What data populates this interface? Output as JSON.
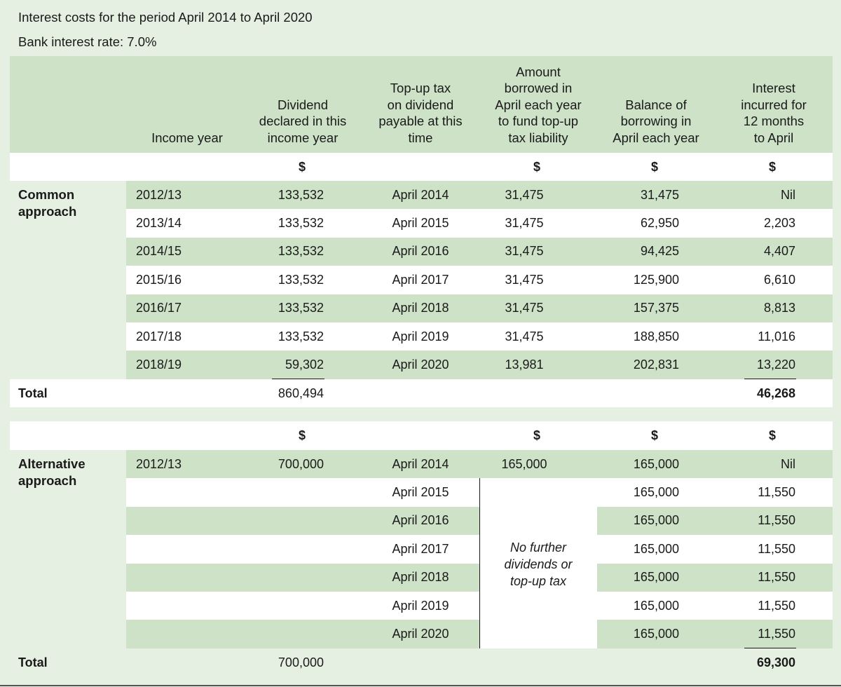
{
  "title": "Interest costs for the period April 2014 to April 2020",
  "subtitle": "Bank interest rate: 7.0%",
  "headers": {
    "income_year": "Income year",
    "dividend": "Dividend\ndeclared in this\nincome year",
    "topup": "Top-up tax\non dividend\npayable at this\ntime",
    "borrowed": "Amount\nborrowed in\nApril each year\nto fund top-up\ntax liability",
    "balance": "Balance of\nborrowing in\nApril each year",
    "interest": "Interest\nincurred for\n12 months\nto April"
  },
  "currency": "$",
  "common": {
    "label": "Common\napproach",
    "rows": [
      {
        "year": "2012/13",
        "dividend": "133,532",
        "due": "April 2014",
        "borrowed": "31,475",
        "balance": "31,475",
        "interest": "Nil"
      },
      {
        "year": "2013/14",
        "dividend": "133,532",
        "due": "April 2015",
        "borrowed": "31,475",
        "balance": "62,950",
        "interest": "2,203"
      },
      {
        "year": "2014/15",
        "dividend": "133,532",
        "due": "April 2016",
        "borrowed": "31,475",
        "balance": "94,425",
        "interest": "4,407"
      },
      {
        "year": "2015/16",
        "dividend": "133,532",
        "due": "April 2017",
        "borrowed": "31,475",
        "balance": "125,900",
        "interest": "6,610"
      },
      {
        "year": "2016/17",
        "dividend": "133,532",
        "due": "April 2018",
        "borrowed": "31,475",
        "balance": "157,375",
        "interest": "8,813"
      },
      {
        "year": "2017/18",
        "dividend": "133,532",
        "due": "April 2019",
        "borrowed": "31,475",
        "balance": "188,850",
        "interest": "11,016"
      },
      {
        "year": "2018/19",
        "dividend": "59,302",
        "due": "April 2020",
        "borrowed": "13,981",
        "balance": "202,831",
        "interest": "13,220"
      }
    ],
    "total_label": "Total",
    "total_dividend": "860,494",
    "total_interest": "46,268"
  },
  "alternative": {
    "label": "Alternative\napproach",
    "rows": [
      {
        "year": "2012/13",
        "dividend": "700,000",
        "due": "April 2014",
        "borrowed": "165,000",
        "balance": "165,000",
        "interest": "Nil"
      },
      {
        "year": "",
        "dividend": "",
        "due": "April 2015",
        "borrowed": "",
        "balance": "165,000",
        "interest": "11,550"
      },
      {
        "year": "",
        "dividend": "",
        "due": "April 2016",
        "borrowed": "",
        "balance": "165,000",
        "interest": "11,550"
      },
      {
        "year": "",
        "dividend": "",
        "due": "April 2017",
        "borrowed": "",
        "balance": "165,000",
        "interest": "11,550"
      },
      {
        "year": "",
        "dividend": "",
        "due": "April 2018",
        "borrowed": "",
        "balance": "165,000",
        "interest": "11,550"
      },
      {
        "year": "",
        "dividend": "",
        "due": "April 2019",
        "borrowed": "",
        "balance": "165,000",
        "interest": "11,550"
      },
      {
        "year": "",
        "dividend": "",
        "due": "April 2020",
        "borrowed": "",
        "balance": "165,000",
        "interest": "11,550"
      }
    ],
    "note": "No further\ndividends or\ntop-up tax",
    "total_label": "Total",
    "total_dividend": "700,000",
    "total_interest": "69,300"
  },
  "colors": {
    "background": "#e6f0e2",
    "band": "#cde2c7",
    "white": "#ffffff"
  }
}
